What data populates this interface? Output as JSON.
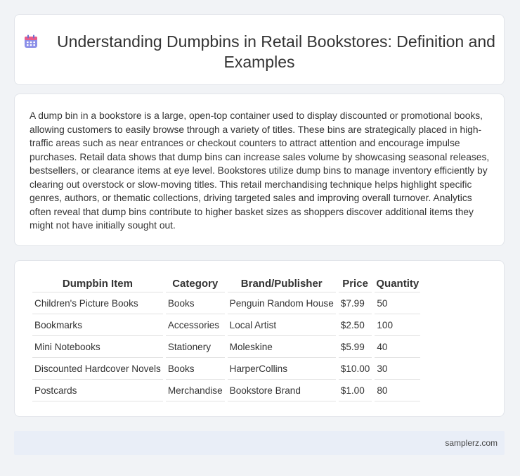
{
  "header": {
    "title": "Understanding Dumpbins in Retail Bookstores: Definition and Examples",
    "icon": "calendar-icon"
  },
  "description": "A dump bin in a bookstore is a large, open-top container used to display discounted or promotional books, allowing customers to easily browse through a variety of titles. These bins are strategically placed in high-traffic areas such as near entrances or checkout counters to attract attention and encourage impulse purchases. Retail data shows that dump bins can increase sales volume by showcasing seasonal releases, bestsellers, or clearance items at eye level. Bookstores utilize dump bins to manage inventory efficiently by clearing out overstock or slow-moving titles. This retail merchandising technique helps highlight specific genres, authors, or thematic collections, driving targeted sales and improving overall turnover. Analytics often reveal that dump bins contribute to higher basket sizes as shoppers discover additional items they might not have initially sought out.",
  "table": {
    "headers": [
      "Dumpbin Item",
      "Category",
      "Brand/Publisher",
      "Price",
      "Quantity"
    ],
    "rows": [
      [
        "Children's Picture Books",
        "Books",
        "Penguin Random House",
        "$7.99",
        "50"
      ],
      [
        "Bookmarks",
        "Accessories",
        "Local Artist",
        "$2.50",
        "100"
      ],
      [
        "Mini Notebooks",
        "Stationery",
        "Moleskine",
        "$5.99",
        "40"
      ],
      [
        "Discounted Hardcover Novels",
        "Books",
        "HarperCollins",
        "$10.00",
        "30"
      ],
      [
        "Postcards",
        "Merchandise",
        "Bookstore Brand",
        "$1.00",
        "80"
      ]
    ]
  },
  "footer": {
    "site": "samplerz.com"
  },
  "colors": {
    "icon_primary": "#8b8fe8",
    "icon_accent": "#e85b8a",
    "footer_bg": "#e9eef7"
  }
}
